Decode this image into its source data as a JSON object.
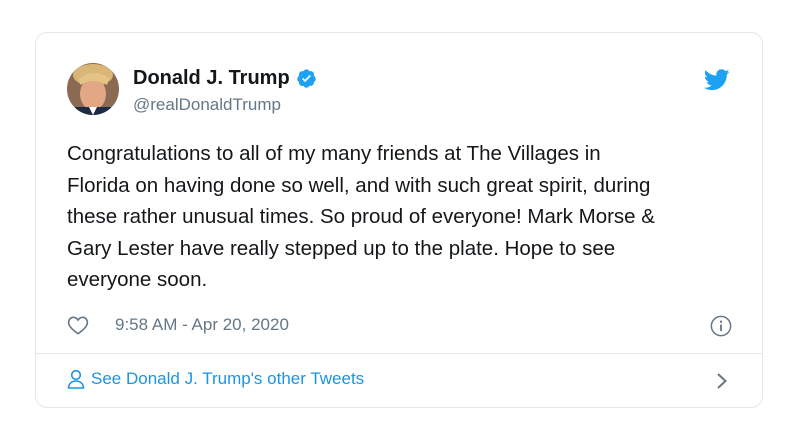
{
  "tweet": {
    "author_name": "Donald J. Trump",
    "handle": "@realDonaldTrump",
    "text": "Congratulations to all of my many friends at The Villages in\nFlorida on having done so well, and with such great spirit, during\nthese rather unusual times. So proud of everyone! Mark Morse &\nGary Lester have really stepped up to the plate. Hope to see\neveryone soon.",
    "timestamp": "9:58 AM - Apr 20, 2020",
    "footer_link": "See Donald J. Trump's other Tweets"
  },
  "icons": {
    "verified": "verified-badge-icon",
    "brand": "twitter-bird-icon",
    "like": "heart-icon",
    "info": "info-icon",
    "person": "person-icon",
    "chevron": "chevron-right-icon"
  },
  "colors": {
    "accent": "#1da1f2",
    "link": "#1b95e0",
    "secondary_text": "#657786",
    "border": "#e1e8ed"
  }
}
